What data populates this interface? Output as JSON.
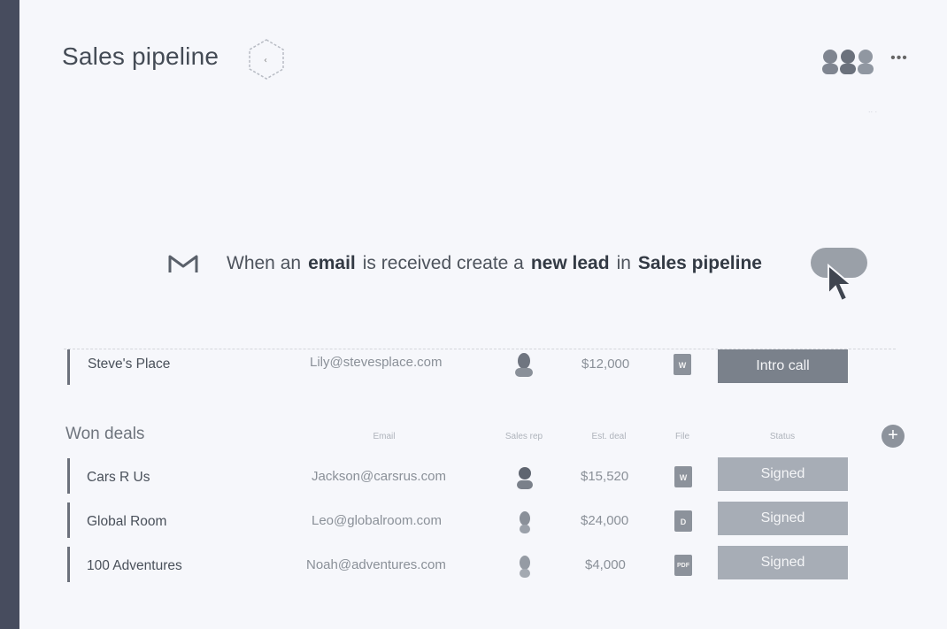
{
  "board": {
    "title": "Sales pipeline"
  },
  "topbar": {
    "more": "•••"
  },
  "recipe": {
    "part1": "When an",
    "bold1": "email",
    "part2": "is received create a",
    "bold2": "new lead",
    "part3": "in",
    "bold3": "Sales pipeline"
  },
  "partial_row": {
    "name": "Steve's Place",
    "email": "Lily@stevesplace.com",
    "amount": "$12,000",
    "file": "W",
    "status": "Intro call"
  },
  "won_group": {
    "title": "Won deals",
    "columns": {
      "email": "Email",
      "sales_rep": "Sales rep",
      "est_deal": "Est. deal",
      "file": "File",
      "status": "Status"
    },
    "add": "+",
    "rows": [
      {
        "name": "Cars R Us",
        "email": "Jackson@carsrus.com",
        "amount": "$15,520",
        "file": "W",
        "status": "Signed"
      },
      {
        "name": "Global Room",
        "email": "Leo@globalroom.com",
        "amount": "$24,000",
        "file": "D",
        "status": "Signed"
      },
      {
        "name": "100 Adventures",
        "email": "Noah@adventures.com",
        "amount": "$4,000",
        "file": "PDF",
        "status": "Signed"
      }
    ]
  },
  "colors": {
    "rail": "#474c5e",
    "status": "#a7adb6",
    "background": "#f6f7fb"
  },
  "icons": [
    "board-badge-icon",
    "people-avatars",
    "more-icon",
    "gmail-icon",
    "toggle",
    "cursor-icon",
    "file-icon",
    "add-column-icon"
  ]
}
